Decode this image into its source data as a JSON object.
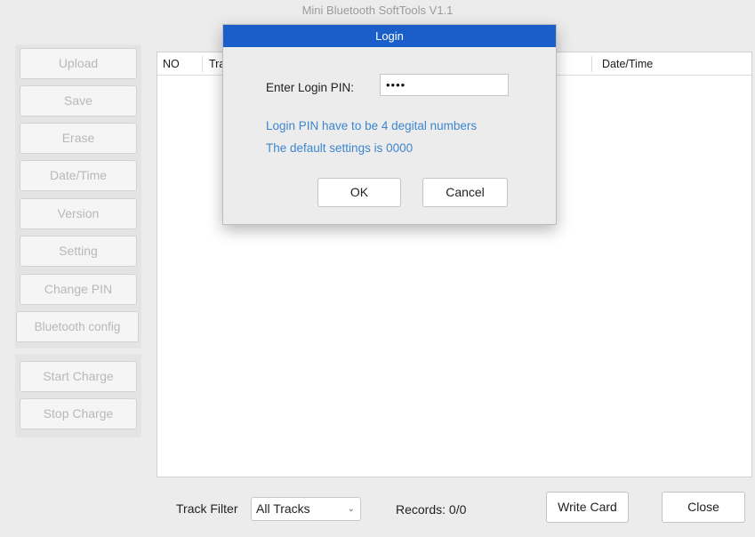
{
  "window": {
    "title": "Mini Bluetooth SoftTools V1.1"
  },
  "sidebar": {
    "items": [
      {
        "label": "Upload"
      },
      {
        "label": "Save"
      },
      {
        "label": "Erase"
      },
      {
        "label": "Date/Time"
      },
      {
        "label": "Version"
      },
      {
        "label": "Setting"
      },
      {
        "label": "Change PIN"
      },
      {
        "label": "Bluetooth config"
      }
    ],
    "charge_items": [
      {
        "label": "Start Charge"
      },
      {
        "label": "Stop Charge"
      }
    ]
  },
  "table": {
    "columns": [
      "NO",
      "Tra",
      "Date/Time"
    ]
  },
  "bottom": {
    "track_filter_label": "Track Filter",
    "track_filter_value": "All Tracks",
    "records_label": "Records: 0/0",
    "write_card_label": "Write Card",
    "close_label": "Close"
  },
  "dialog": {
    "title": "Login",
    "pin_label": "Enter Login PIN:",
    "pin_value": "••••",
    "hint_line1": "Login PIN have to be 4 degital numbers",
    "hint_line2": "The default settings is 0000",
    "ok_label": "OK",
    "cancel_label": "Cancel"
  },
  "colors": {
    "dialog_title_bar": "#1a5fc9",
    "hint_text": "#3d86cf",
    "disabled_text": "#b8b8b8"
  }
}
